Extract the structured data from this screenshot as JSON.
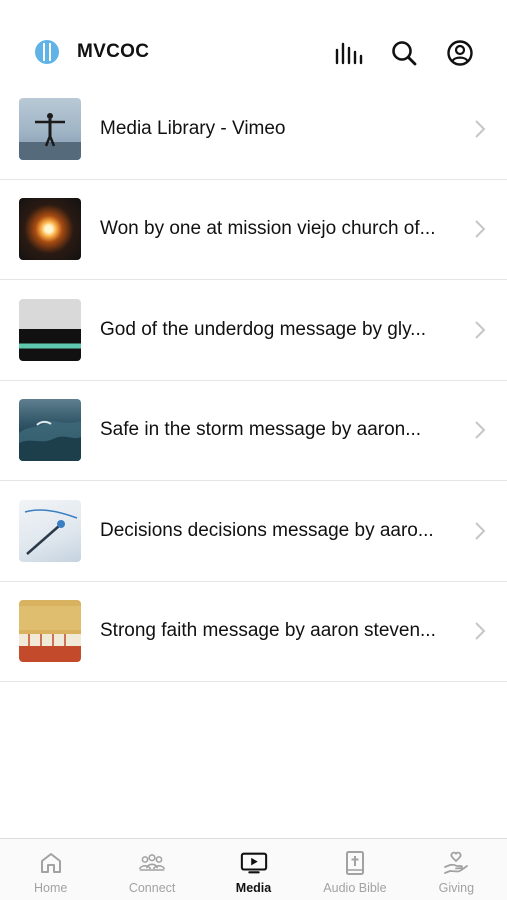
{
  "header": {
    "app_title": "MVCOC",
    "icons": [
      "logo-icon",
      "audio-bars-icon",
      "search-icon",
      "profile-icon"
    ]
  },
  "media_list": [
    {
      "title": "Media Library - Vimeo",
      "thumb": "vimeo"
    },
    {
      "title": "Won by one at mission viejo church of...",
      "thumb": "fire"
    },
    {
      "title": "God of the underdog message by gly...",
      "thumb": "underdog"
    },
    {
      "title": "Safe in the storm message by aaron...",
      "thumb": "storm"
    },
    {
      "title": "Decisions decisions message by aaro...",
      "thumb": "decisions"
    },
    {
      "title": "Strong faith message by aaron steven...",
      "thumb": "faith"
    }
  ],
  "tabbar": {
    "tabs": [
      {
        "label": "Home",
        "icon": "home-icon",
        "active": false
      },
      {
        "label": "Connect",
        "icon": "people-icon",
        "active": false
      },
      {
        "label": "Media",
        "icon": "media-play-icon",
        "active": true
      },
      {
        "label": "Audio Bible",
        "icon": "bible-icon",
        "active": false
      },
      {
        "label": "Giving",
        "icon": "giving-hand-icon",
        "active": false
      }
    ]
  },
  "colors": {
    "accent": "#111111",
    "inactive": "#a2a2a2",
    "logo": "#5fb3e6",
    "divider": "#e6e6e6"
  }
}
